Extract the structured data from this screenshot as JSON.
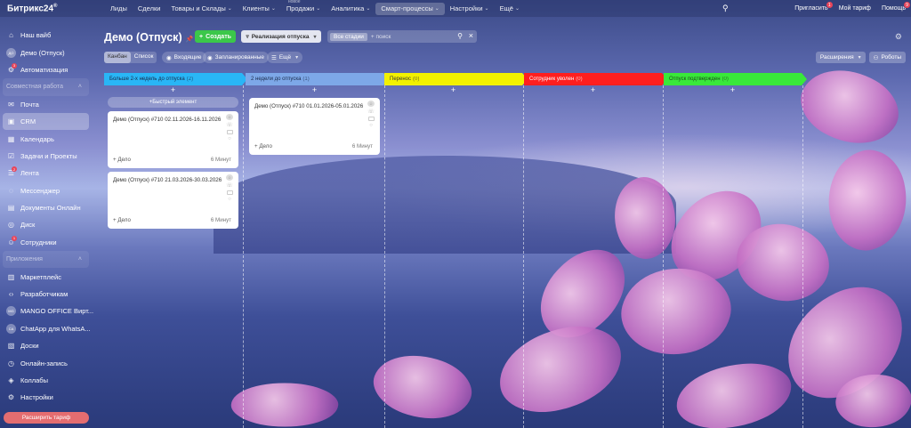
{
  "app": {
    "logo": "Битрикс24",
    "logo_mark": "®"
  },
  "topmenu": [
    {
      "label": "Лиды"
    },
    {
      "label": "Сделки"
    },
    {
      "label": "Товары и Склады",
      "chevron": true
    },
    {
      "label": "Клиенты",
      "chevron": true
    },
    {
      "label": "Продажи",
      "chevron": true,
      "note": "новое"
    },
    {
      "label": "Аналитика",
      "chevron": true
    },
    {
      "label": "Смарт-процессы",
      "chevron": true,
      "active": true
    },
    {
      "label": "Настройки",
      "chevron": true
    },
    {
      "label": "Ещё",
      "chevron": true
    }
  ],
  "topright": {
    "invite": "Пригласить",
    "invite_badge": "1",
    "plan": "Мой тариф",
    "help": "Помощь",
    "help_badge": "9"
  },
  "sidebar": {
    "items": [
      {
        "label": "Наш вайб",
        "icon": "home-icon"
      },
      {
        "label": "Демо (Отпуск)",
        "avatar": "ДО"
      },
      {
        "label": "Автоматизация",
        "icon": "robot-icon",
        "badge": "3"
      },
      {
        "label": "Совместная работа",
        "group": true
      },
      {
        "label": "Почта",
        "icon": "mail-icon"
      },
      {
        "label": "CRM",
        "icon": "crm-icon",
        "active": true
      },
      {
        "label": "Календарь",
        "icon": "calendar-icon"
      },
      {
        "label": "Задачи и Проекты",
        "icon": "tasks-icon"
      },
      {
        "label": "Лента",
        "icon": "feed-icon",
        "badge": "2"
      },
      {
        "label": "Мессенджер",
        "icon": "chat-icon"
      },
      {
        "label": "Документы Онлайн",
        "icon": "docs-icon"
      },
      {
        "label": "Диск",
        "icon": "disk-icon"
      },
      {
        "label": "Сотрудники",
        "icon": "users-icon",
        "badge": "1"
      },
      {
        "label": "Приложения",
        "group": true
      },
      {
        "label": "Маркетплейс",
        "icon": "market-icon"
      },
      {
        "label": "Разработчикам",
        "icon": "code-icon"
      },
      {
        "label": "MANGO OFFICE Вирт...",
        "avatar": "MG"
      },
      {
        "label": "ChatApp для WhatsA...",
        "avatar": "CA"
      },
      {
        "label": "Доски",
        "icon": "boards-icon"
      },
      {
        "label": "Онлайн-запись",
        "icon": "booking-icon"
      },
      {
        "label": "Коллабы",
        "icon": "collab-icon"
      },
      {
        "label": "Настройки",
        "icon": "gear-icon"
      }
    ],
    "upgrade": "Расширить тариф"
  },
  "header": {
    "title": "Демо (Отпуск)",
    "create": "Создать",
    "funnel": "Реализация отпуска",
    "search_tag": "Все стадии",
    "search_placeholder": "+ поиск"
  },
  "toolbar": {
    "view_kanban": "Канбан",
    "view_list": "Список",
    "incoming": "Входящие",
    "planned": "Запланированные",
    "more": "Ещё",
    "extensions": "Расширения",
    "robots": "Роботы"
  },
  "kanban": {
    "quick_add": "Быстрый элемент",
    "stages": [
      {
        "name": "Больше 2-х недель до отпуска",
        "count": "(2)",
        "color": "cyan",
        "cards": [
          {
            "title": "Демо (Отпуск) #710 02.11.2026-16.11.2026",
            "action": "+ Дело",
            "time": "6 Минут"
          },
          {
            "title": "Демо (Отпуск) #710 21.03.2026-30.03.2026",
            "action": "+ Дело",
            "time": "6 Минут"
          }
        ]
      },
      {
        "name": "2 недели до отпуска",
        "count": "(1)",
        "color": "lblue",
        "cards": [
          {
            "title": "Демо (Отпуск) #710 01.01.2026-05.01.2026",
            "action": "+ Дело",
            "time": "6 Минут"
          }
        ]
      },
      {
        "name": "Перенос",
        "count": "(0)",
        "color": "yellow",
        "cards": []
      },
      {
        "name": "Сотрудник уволен",
        "count": "(0)",
        "color": "red",
        "cards": []
      },
      {
        "name": "Отпуск подтвержден",
        "count": "(0)",
        "color": "green",
        "cards": []
      }
    ]
  },
  "colors": {
    "create": "#3bc74a",
    "upgrade": "#e46d70"
  }
}
